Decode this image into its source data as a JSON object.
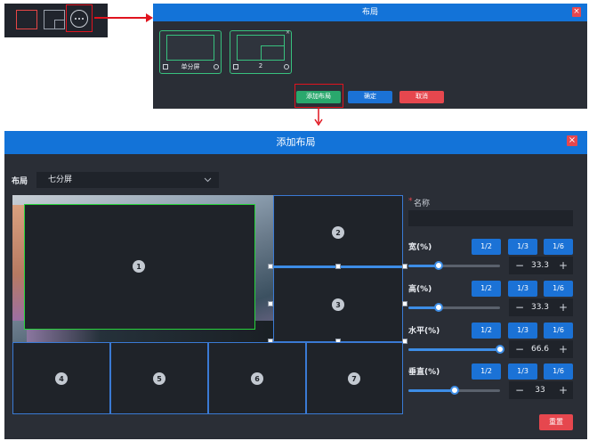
{
  "top_dialog": {
    "title": "布局",
    "close_icon": "close-icon",
    "layouts": [
      {
        "label": "单分屏"
      },
      {
        "label": "2"
      }
    ],
    "add_label": "添加布局",
    "confirm_label": "确定",
    "cancel_label": "取消"
  },
  "main_dialog": {
    "title": "添加布局",
    "layout_label": "布局",
    "layout_value": "七分屏",
    "cells": [
      "1",
      "2",
      "3",
      "4",
      "5",
      "6",
      "7"
    ],
    "name_label": "名称",
    "required_mark": "*",
    "name_value": "",
    "reset_label": "重置",
    "fractions": [
      "1/2",
      "1/3",
      "1/6"
    ],
    "controls": [
      {
        "label": "宽(%)",
        "value": "33.3",
        "percent": 33.3
      },
      {
        "label": "高(%)",
        "value": "33.3",
        "percent": 33.3
      },
      {
        "label": "水平(%)",
        "value": "66.6",
        "percent": 100
      },
      {
        "label": "垂直(%)",
        "value": "33",
        "percent": 50
      }
    ],
    "minus_glyph": "−",
    "plus_glyph": "+"
  },
  "colors": {
    "accent": "#1373d8",
    "danger": "#e6474e",
    "success": "#2aa86d",
    "highlight": "#e0141e",
    "selected_border": "#27d43b",
    "cell_border": "#3a7ad4"
  }
}
